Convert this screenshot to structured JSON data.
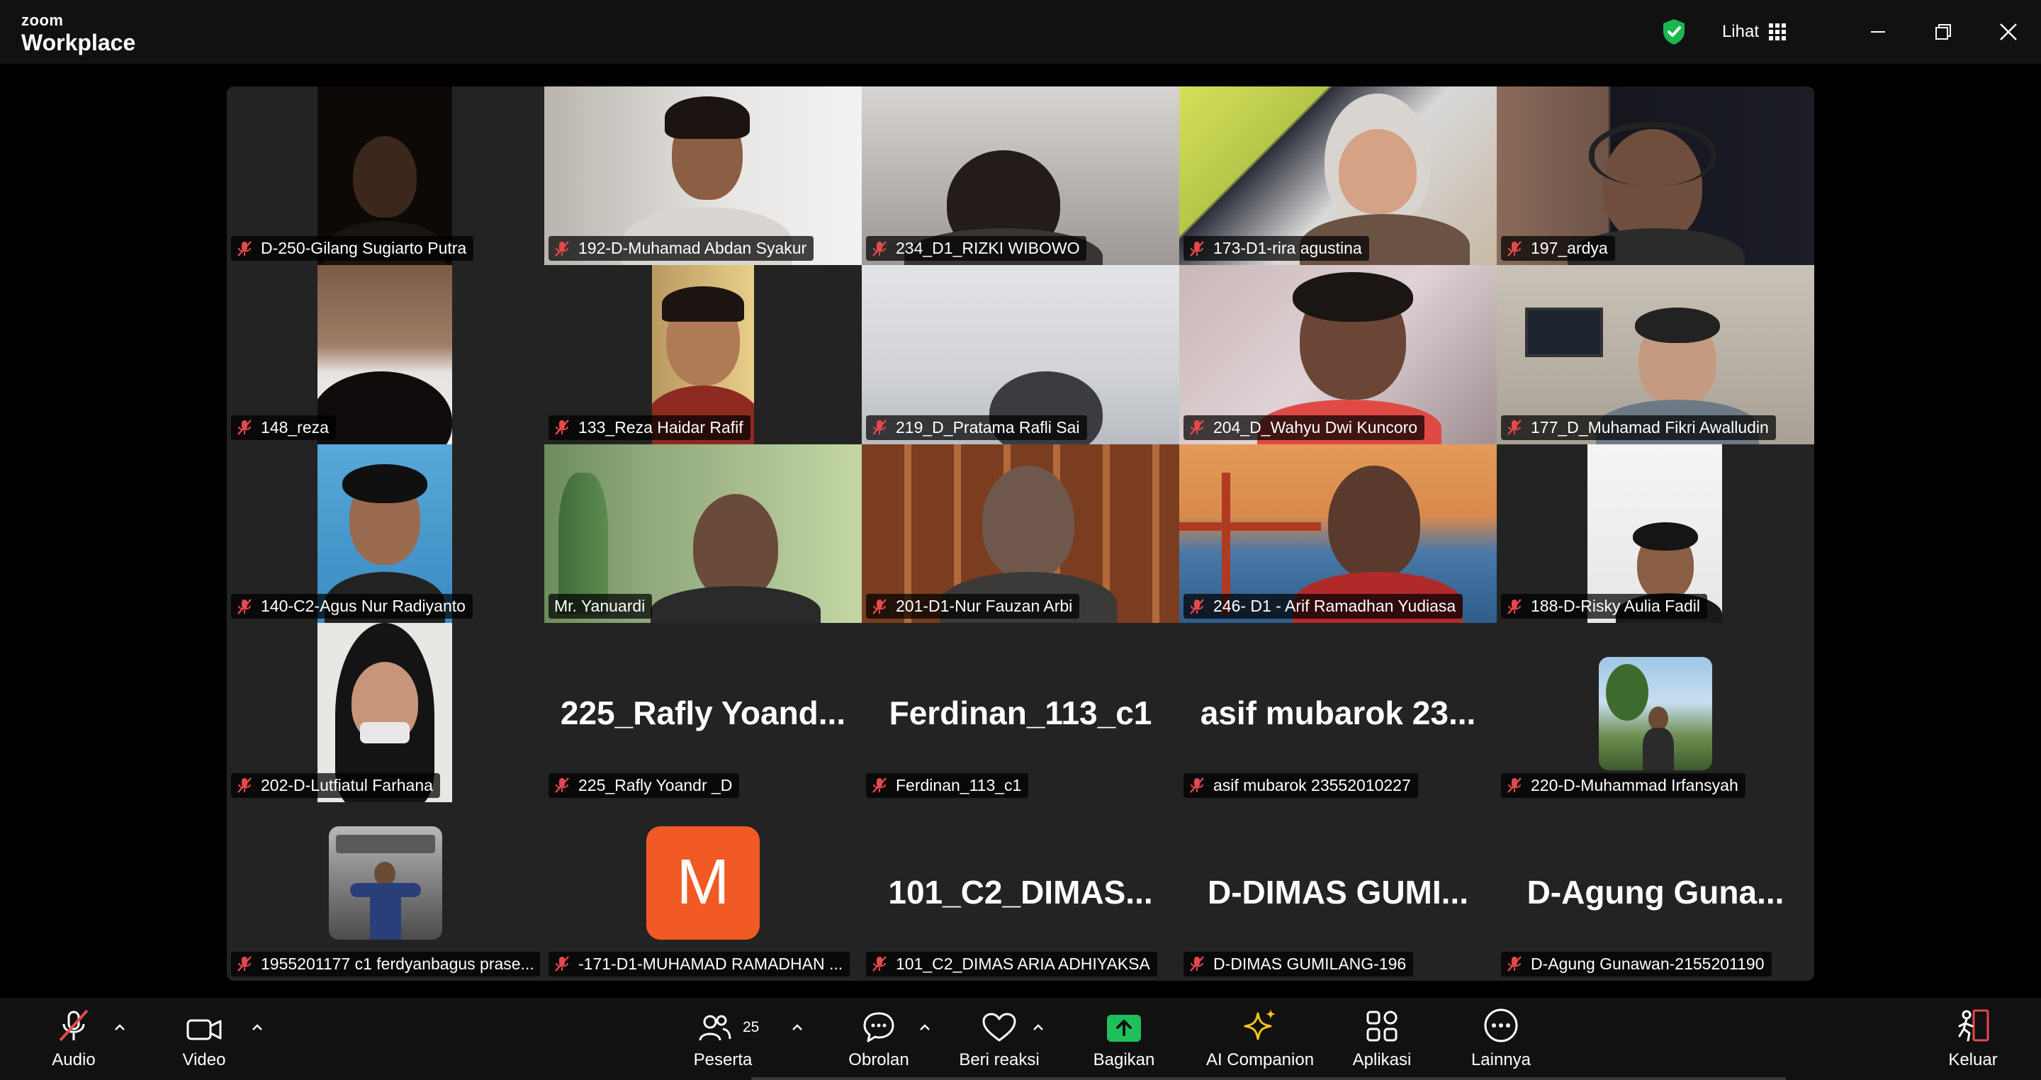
{
  "app": {
    "brand_small": "zoom",
    "brand_large": "Workplace"
  },
  "titlebar": {
    "view_label": "Lihat"
  },
  "participants": [
    {
      "name": "D-250-Gilang Sugiarto Putra",
      "type": "video",
      "muted": true
    },
    {
      "name": "192-D-Muhamad Abdan Syakur",
      "type": "video",
      "muted": true
    },
    {
      "name": "234_D1_RIZKI WIBOWO",
      "type": "video",
      "muted": true
    },
    {
      "name": "173-D1-rira agustina",
      "type": "video",
      "muted": true
    },
    {
      "name": "197_ardya",
      "type": "video",
      "muted": true
    },
    {
      "name": "148_reza",
      "type": "video",
      "muted": true
    },
    {
      "name": "133_Reza Haidar Rafif",
      "type": "video",
      "muted": true
    },
    {
      "name": "219_D_Pratama Rafli Sai",
      "type": "video",
      "muted": true
    },
    {
      "name": "204_D_Wahyu Dwi Kuncoro",
      "type": "video",
      "muted": true
    },
    {
      "name": "177_D_Muhamad Fikri Awalludin",
      "type": "video",
      "muted": true
    },
    {
      "name": "140-C2-Agus Nur Radiyanto",
      "type": "video",
      "muted": true
    },
    {
      "name": "Mr. Yanuardi",
      "type": "video",
      "muted": false,
      "active_speaker": true
    },
    {
      "name": "201-D1-Nur Fauzan Arbi",
      "type": "video",
      "muted": true
    },
    {
      "name": "246- D1 - Arif Ramadhan Yudiasa",
      "type": "video",
      "muted": true
    },
    {
      "name": "188-D-Risky Aulia Fadil",
      "type": "video",
      "muted": true
    },
    {
      "name": "202-D-Lutfiatul Farhana",
      "type": "video",
      "muted": true
    },
    {
      "name": "225_Rafly Yoandr _D",
      "type": "name",
      "display": "225_Rafly  Yoand...",
      "muted": true
    },
    {
      "name": "Ferdinan_113_c1",
      "type": "name",
      "display": "Ferdinan_113_c1",
      "muted": true
    },
    {
      "name": "asif mubarok 23552010227",
      "type": "name",
      "display": "asif  mubarok  23...",
      "muted": true
    },
    {
      "name": "220-D-Muhammad Irfansyah",
      "type": "avatar",
      "muted": true
    },
    {
      "name": "1955201177 c1 ferdyanbagus prase...",
      "type": "avatar",
      "muted": true
    },
    {
      "name": "-171-D1-MUHAMAD RAMADHAN ...",
      "type": "letter",
      "letter": "M",
      "muted": true
    },
    {
      "name": "101_C2_DIMAS ARIA ADHIYAKSA",
      "type": "name",
      "display": "101_C2_DIMAS...",
      "muted": true
    },
    {
      "name": "D-DIMAS GUMILANG-196",
      "type": "name",
      "display": "D-DIMAS  GUMI...",
      "muted": true
    },
    {
      "name": "D-Agung Gunawan-2155201190",
      "type": "name",
      "display": "D-Agung  Guna...",
      "muted": true
    }
  ],
  "toolbar": {
    "audio": "Audio",
    "video": "Video",
    "participants": "Peserta",
    "participants_count": "25",
    "chat": "Obrolan",
    "react": "Beri reaksi",
    "share": "Bagikan",
    "ai": "AI Companion",
    "apps": "Aplikasi",
    "more": "Lainnya",
    "leave": "Keluar"
  },
  "colors": {
    "active_border": "#2ec26c",
    "share_green": "#1fbf5c",
    "muted_red": "#e5484d",
    "ai_yellow": "#f5c518"
  }
}
